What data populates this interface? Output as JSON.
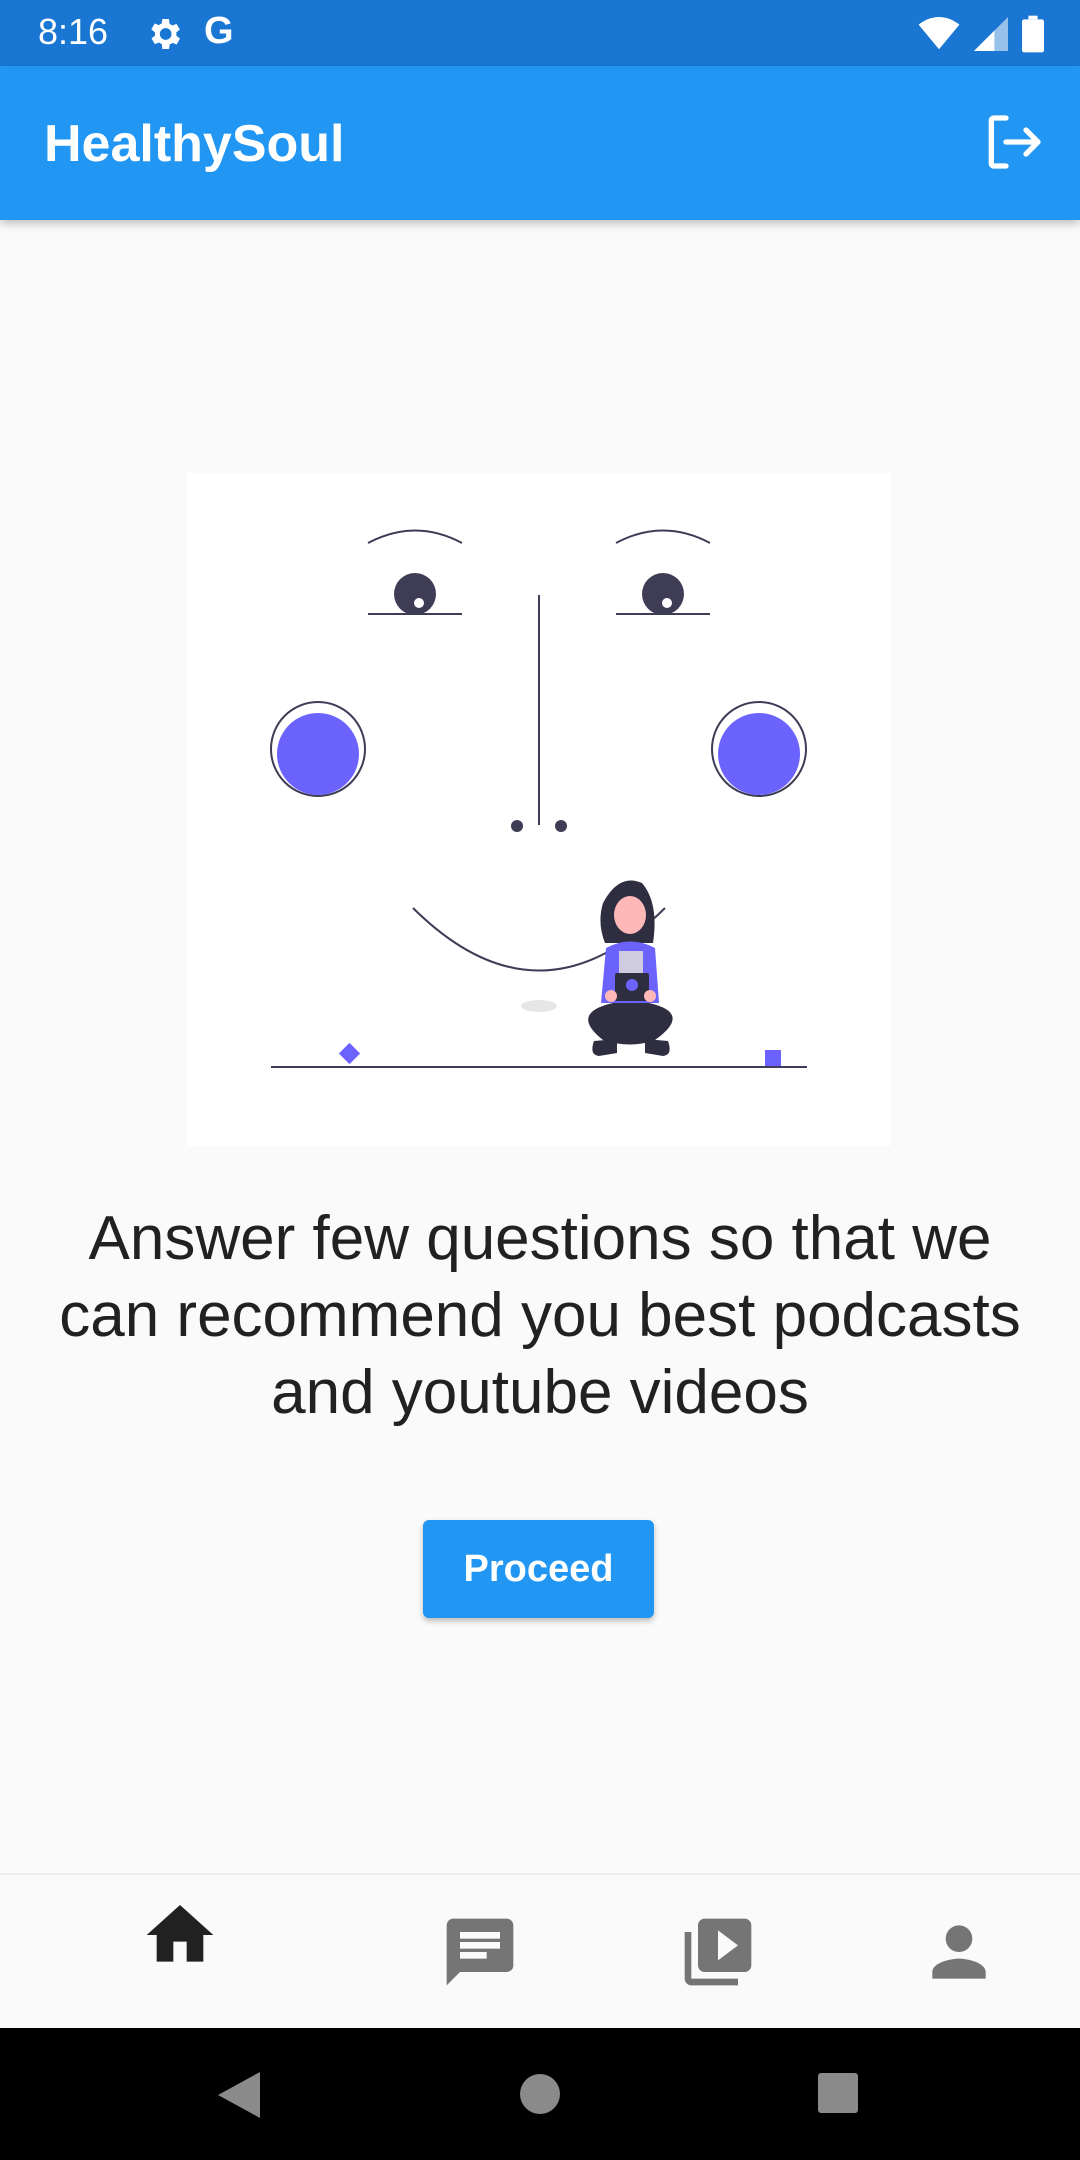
{
  "status_bar": {
    "time": "8:16",
    "g_label": "G",
    "icons": [
      "gear-icon",
      "wifi-icon",
      "signal-icon",
      "battery-icon"
    ]
  },
  "app_bar": {
    "title": "HealthySoul",
    "action_icon": "logout-icon"
  },
  "main": {
    "message": "Answer few questions so that we can recommend you best podcasts and youtube videos",
    "proceed_label": "Proceed"
  },
  "bottom_nav": {
    "items": [
      {
        "icon": "home-icon",
        "active": true
      },
      {
        "icon": "chat-icon",
        "active": false
      },
      {
        "icon": "video-library-icon",
        "active": false
      },
      {
        "icon": "person-icon",
        "active": false
      }
    ]
  },
  "system_nav": {
    "buttons": [
      "back-icon",
      "home-circle-icon",
      "recents-icon"
    ]
  },
  "colors": {
    "status_bar": "#1976d2",
    "app_bar": "#2196f3",
    "accent_purple": "#6c63ff",
    "background": "#fafafa"
  }
}
